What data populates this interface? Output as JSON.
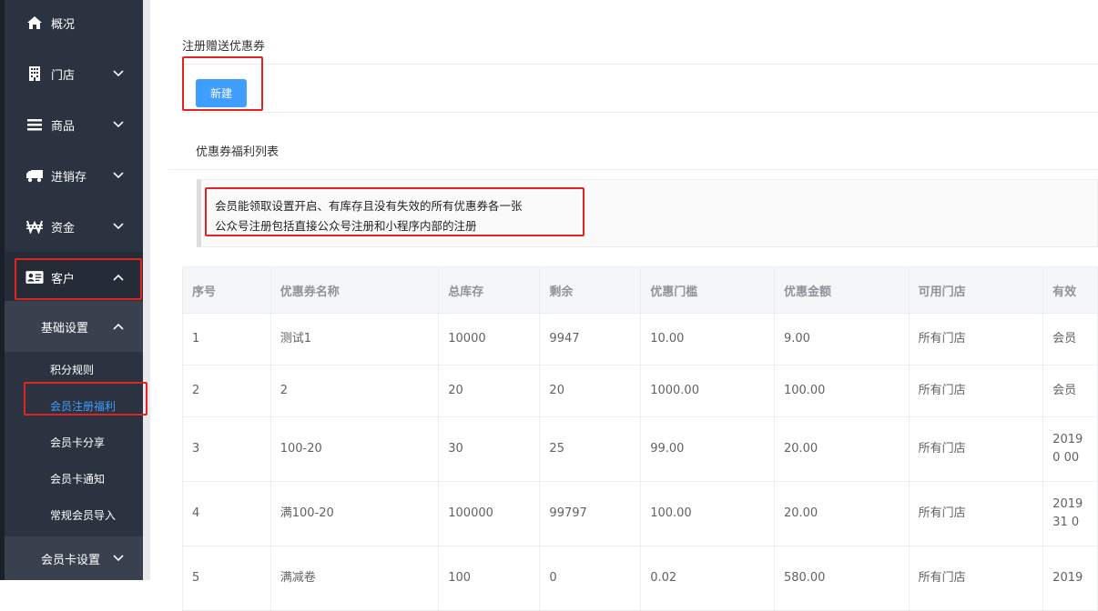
{
  "sidebar": {
    "items": [
      {
        "label": "概况",
        "icon": "home-icon"
      },
      {
        "label": "门店",
        "icon": "building-icon"
      },
      {
        "label": "商品",
        "icon": "list-icon"
      },
      {
        "label": "进销存",
        "icon": "truck-icon"
      },
      {
        "label": "资金",
        "icon": "won-icon"
      },
      {
        "label": "客户",
        "icon": "id-card-icon"
      }
    ],
    "submenu_label": "基础设置",
    "leaves": [
      "积分规则",
      "会员注册福利",
      "会员卡分享",
      "会员卡通知",
      "常规会员导入"
    ],
    "bottom_item": "会员卡设置",
    "accent_color": "#409eff"
  },
  "main": {
    "section_title": "注册赠送优惠券",
    "new_button": "新建",
    "list_title": "优惠券福利列表",
    "notice_lines": [
      "会员能领取设置开启、有库存且没有失效的所有优惠券各一张",
      "公众号注册包括直接公众号注册和小程序内部的注册"
    ],
    "table": {
      "headers": [
        "序号",
        "优惠券名称",
        "总库存",
        "剩余",
        "优惠门槛",
        "优惠金额",
        "可用门店",
        "有效"
      ],
      "rows": [
        {
          "no": "1",
          "name": "测试1",
          "total": "10000",
          "left": "9947",
          "threshold": "10.00",
          "amount": "9.00",
          "store": "所有门店",
          "valid": "会员"
        },
        {
          "no": "2",
          "name": "2",
          "total": "20",
          "left": "20",
          "threshold": "1000.00",
          "amount": "100.00",
          "store": "所有门店",
          "valid": "会员"
        },
        {
          "no": "3",
          "name": "100-20",
          "total": "30",
          "left": "25",
          "threshold": "99.00",
          "amount": "20.00",
          "store": "所有门店",
          "valid": "2019",
          "valid2": "0 00"
        },
        {
          "no": "4",
          "name": "满100-20",
          "total": "100000",
          "left": "99797",
          "threshold": "100.00",
          "amount": "20.00",
          "store": "所有门店",
          "valid": "2019",
          "valid2": "31 0"
        },
        {
          "no": "5",
          "name": "满减卷",
          "total": "100",
          "left": "0",
          "threshold": "0.02",
          "amount": "580.00",
          "store": "所有门店",
          "valid": "2019"
        }
      ]
    }
  },
  "highlight_color": "#e02424"
}
